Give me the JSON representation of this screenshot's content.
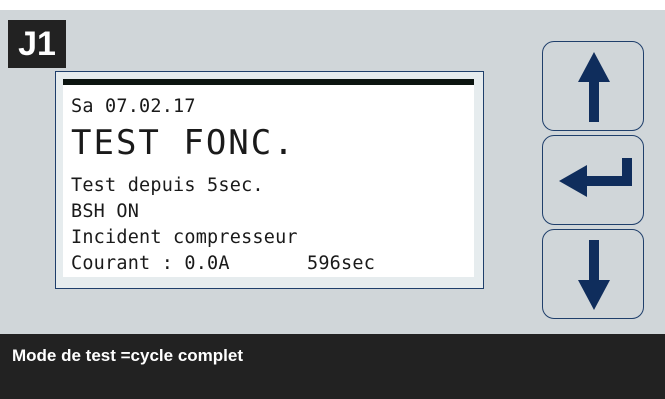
{
  "tag": {
    "label": "J1"
  },
  "display": {
    "date": "Sa 07.02.17",
    "title": "TEST FONC.",
    "line3": "Test depuis 5sec.",
    "line4": "BSH ON",
    "line5": "Incident compresseur",
    "current": "Courant : 0.0A",
    "seconds": "596sec"
  },
  "buttons": {
    "up": "arrow-up-icon",
    "enter": "enter-icon",
    "down": "arrow-down-icon"
  },
  "caption": {
    "text": "Mode de test =cycle complet"
  },
  "colors": {
    "navy": "#0f2d5c",
    "panel": "#d0d6d9",
    "dark": "#222222"
  }
}
